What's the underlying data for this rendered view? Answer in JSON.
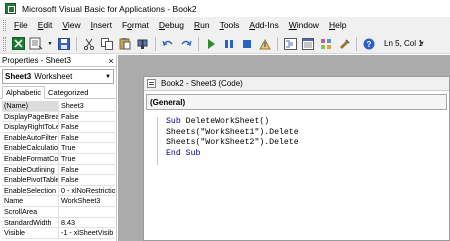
{
  "window": {
    "title": "Microsoft Visual Basic for Applications - Book2"
  },
  "menu": [
    {
      "acc": "F",
      "rest": "ile"
    },
    {
      "acc": "E",
      "rest": "dit"
    },
    {
      "acc": "V",
      "rest": "iew"
    },
    {
      "acc": "I",
      "rest": "nsert"
    },
    {
      "pre": "F",
      "acc": "o",
      "rest": "rmat"
    },
    {
      "acc": "D",
      "rest": "ebug"
    },
    {
      "acc": "R",
      "rest": "un"
    },
    {
      "acc": "T",
      "rest": "ools"
    },
    {
      "acc": "A",
      "rest": "dd-Ins"
    },
    {
      "acc": "W",
      "rest": "indow"
    },
    {
      "acc": "H",
      "rest": "elp"
    }
  ],
  "toolbar": {
    "position": "Ln 5, Col 1"
  },
  "properties": {
    "title": "Properties - Sheet3",
    "close": "×",
    "object_name": "Sheet3",
    "object_type": "Worksheet",
    "tabs": [
      "Alphabetic",
      "Categorized"
    ],
    "rows": [
      {
        "key": "(Name)",
        "value": "Sheet3"
      },
      {
        "key": "DisplayPageBreak",
        "value": "False"
      },
      {
        "key": "DisplayRightToLef",
        "value": "False"
      },
      {
        "key": "EnableAutoFilter",
        "value": "False"
      },
      {
        "key": "EnableCalculation",
        "value": "True"
      },
      {
        "key": "EnableFormatCon",
        "value": "True"
      },
      {
        "key": "EnableOutlining",
        "value": "False"
      },
      {
        "key": "EnablePivotTable",
        "value": "False"
      },
      {
        "key": "EnableSelection",
        "value": "0 - xlNoRestrictio"
      },
      {
        "key": "Name",
        "value": "WorkSheet3"
      },
      {
        "key": "ScrollArea",
        "value": ""
      },
      {
        "key": "StandardWidth",
        "value": "8.43"
      },
      {
        "key": "Visible",
        "value": "-1 - xlSheetVisib"
      }
    ]
  },
  "code_window": {
    "title": "Book2 - Sheet3 (Code)",
    "object": "(General)",
    "lines": [
      "Sub DeleteWorkSheet()",
      "Sheets(\"WorkSheet1\").Delete",
      "Sheets(\"WorkSheet2\").Delete",
      "End Sub"
    ]
  },
  "colors": {
    "mdi_background": "#ababab",
    "keyword": "#00008b"
  }
}
